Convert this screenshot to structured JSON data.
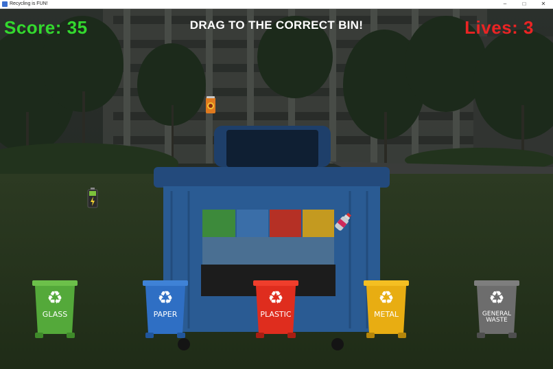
{
  "window": {
    "title": "Recycling is FUN!",
    "controls": [
      "–",
      "□",
      "✕"
    ]
  },
  "hud": {
    "score_label": "Score: 35",
    "lives_label": "Lives: 3",
    "instruction": "DRAG TO THE CORRECT BIN!"
  },
  "falling_items": [
    {
      "name": "drink-can",
      "icon": "soda-can-icon"
    },
    {
      "name": "battery",
      "icon": "battery-icon"
    },
    {
      "name": "plastic-bottle",
      "icon": "bottle-icon"
    }
  ],
  "bins": [
    {
      "key": "glass",
      "label": "GLASS",
      "color": "#54a93a"
    },
    {
      "key": "paper",
      "label": "PAPER",
      "color": "#2f6fc4"
    },
    {
      "key": "plastic",
      "label": "PLASTIC",
      "color": "#df2d1e"
    },
    {
      "key": "metal",
      "label": "METAL",
      "color": "#e8ad12"
    },
    {
      "key": "general",
      "label_line1": "GENERAL",
      "label_line2": "WASTE",
      "color": "#6d6d6d"
    }
  ],
  "colors": {
    "score": "#33d92e",
    "lives": "#ea2424",
    "instruction": "#ffffff"
  }
}
